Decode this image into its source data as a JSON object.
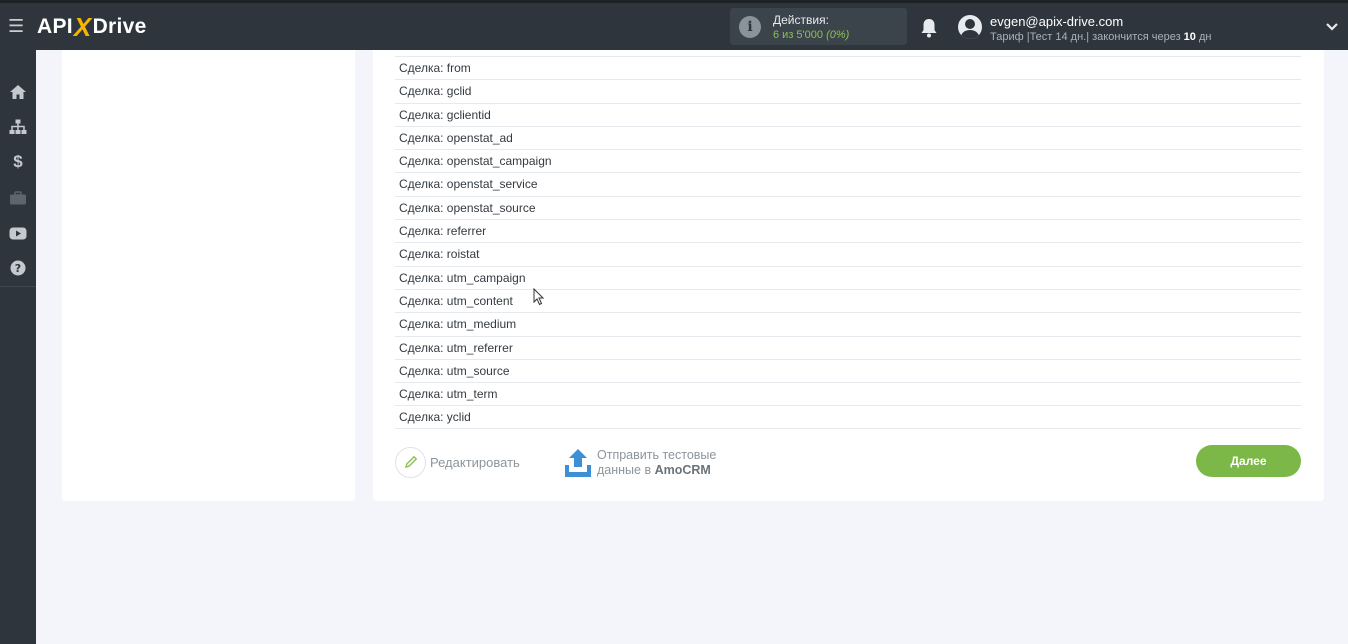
{
  "app": {
    "logo_left": "API",
    "logo_x": "X",
    "logo_right": "Drive"
  },
  "header": {
    "actions_label": "Действия:",
    "actions_value": "6 из 5'000",
    "actions_percent": "(0%)",
    "email": "evgen@apix-drive.com",
    "plan_prefix": "Тариф |Тест 14 дн.| закончится через ",
    "plan_days": "10",
    "plan_suffix": " дн"
  },
  "sidebar": {
    "items": [
      "home-icon",
      "sitemap-icon",
      "dollar-icon",
      "briefcase-icon",
      "youtube-icon",
      "help-icon"
    ]
  },
  "fields": [
    "Сделка: from",
    "Сделка: gclid",
    "Сделка: gclientid",
    "Сделка: openstat_ad",
    "Сделка: openstat_campaign",
    "Сделка: openstat_service",
    "Сделка: openstat_source",
    "Сделка: referrer",
    "Сделка: roistat",
    "Сделка: utm_campaign",
    "Сделка: utm_content",
    "Сделка: utm_medium",
    "Сделка: utm_referrer",
    "Сделка: utm_source",
    "Сделка: utm_term",
    "Сделка: yclid"
  ],
  "footer": {
    "edit_label": "Редактировать",
    "send_line1": "Отправить тестовые",
    "send_line2_prefix": "данные в ",
    "send_line2_service": "AmoCRM",
    "next_label": "Далее"
  },
  "colors": {
    "accent_green": "#7cb848",
    "topbar": "#2e353c",
    "logo_x": "#f7b500"
  }
}
